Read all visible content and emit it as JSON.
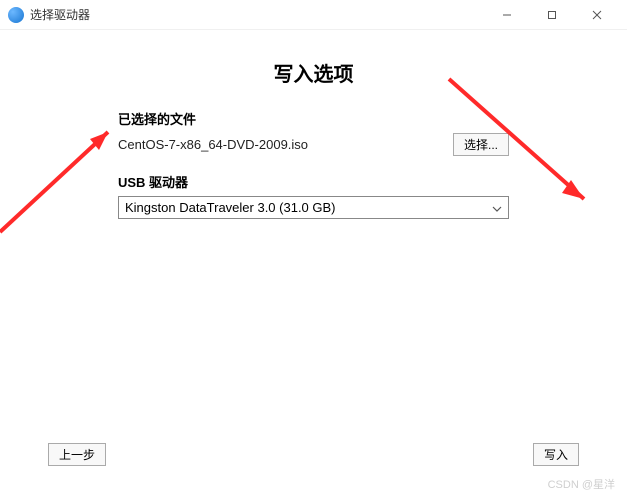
{
  "window": {
    "title": "选择驱动器"
  },
  "page": {
    "title": "写入选项"
  },
  "file": {
    "label": "已选择的文件",
    "name": "CentOS-7-x86_64-DVD-2009.iso",
    "browse_label": "选择..."
  },
  "drive": {
    "label": "USB 驱动器",
    "selected": "Kingston DataTraveler 3.0 (31.0 GB)"
  },
  "buttons": {
    "back": "上一步",
    "write": "写入"
  },
  "watermark": "CSDN @星洋"
}
